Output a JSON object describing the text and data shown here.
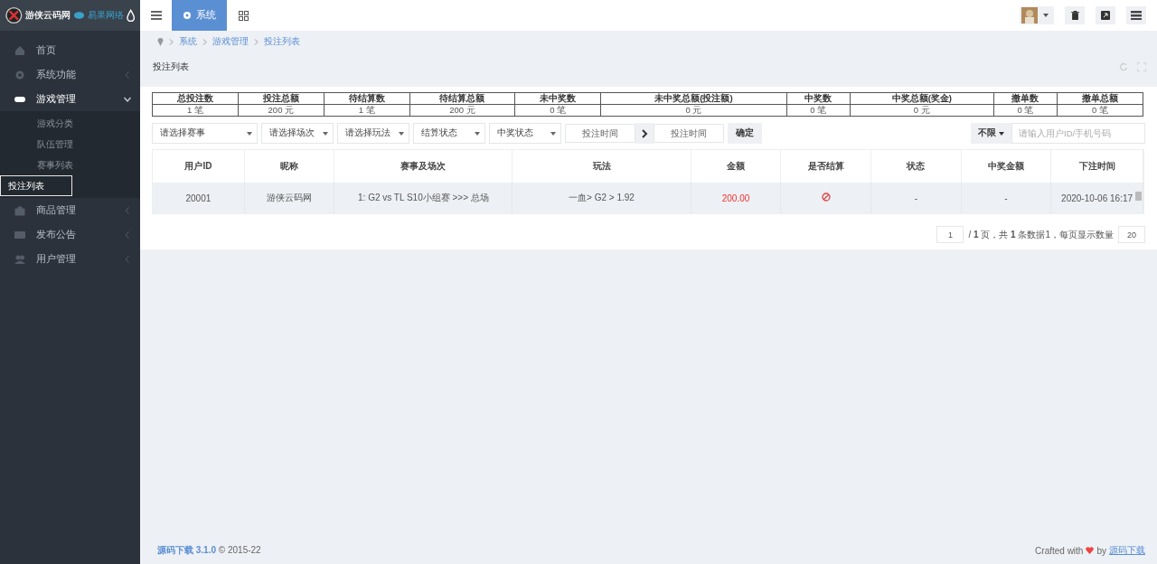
{
  "logo": {
    "brand": "游侠云码网",
    "partner": "易果网络"
  },
  "topbar": {
    "tabs": [
      {
        "label": "系统",
        "selected": true
      }
    ]
  },
  "sidebar": {
    "items": [
      {
        "label": "首页",
        "kind": "link"
      },
      {
        "label": "系统功能",
        "kind": "group",
        "expanded": false
      },
      {
        "label": "游戏管理",
        "kind": "group",
        "expanded": true,
        "children": [
          {
            "label": "游戏分类",
            "selected": false
          },
          {
            "label": "队伍管理",
            "selected": false
          },
          {
            "label": "赛事列表",
            "selected": false
          },
          {
            "label": "投注列表",
            "selected": true
          }
        ]
      },
      {
        "label": "商品管理",
        "kind": "group",
        "expanded": false
      },
      {
        "label": "发布公告",
        "kind": "group",
        "expanded": false
      },
      {
        "label": "用户管理",
        "kind": "group",
        "expanded": false
      }
    ]
  },
  "breadcrumb": [
    "系统",
    "游戏管理",
    "投注列表"
  ],
  "panel": {
    "title": "投注列表"
  },
  "stats": [
    {
      "label": "总投注数",
      "value": "1 笔"
    },
    {
      "label": "投注总额",
      "value": "200 元"
    },
    {
      "label": "待结算数",
      "value": "1 笔"
    },
    {
      "label": "待结算总额",
      "value": "200 元"
    },
    {
      "label": "未中奖数",
      "value": "0 笔"
    },
    {
      "label": "未中奖总额(投注额)",
      "value": "0 元"
    },
    {
      "label": "中奖数",
      "value": "0 笔"
    },
    {
      "label": "中奖总额(奖金)",
      "value": "0 元"
    },
    {
      "label": "撤单数",
      "value": "0 笔"
    },
    {
      "label": "撤单总额",
      "value": "0 笔"
    }
  ],
  "filters": {
    "selects": [
      "请选择赛事",
      "请选择场次",
      "请选择玩法",
      "结算状态",
      "中奖状态"
    ],
    "date_from": {
      "placeholder": "投注时间"
    },
    "date_to": {
      "placeholder": "投注时间"
    },
    "confirm": "确定",
    "scope": "不限",
    "search": {
      "placeholder": "请输入用户ID/手机号码"
    }
  },
  "table": {
    "columns": [
      "用户ID",
      "昵称",
      "赛事及场次",
      "玩法",
      "金额",
      "是否结算",
      "状态",
      "中奖金额",
      "下注时间"
    ],
    "rows": [
      {
        "user_id": "20001",
        "nickname": "游侠云码网",
        "match": "1: G2 vs TL S10小组赛 >>> 总场",
        "play": "一血> G2 > 1.92",
        "amount": "200.00",
        "settled": false,
        "status": "-",
        "prize": "-",
        "time": "2020-10-06 16:17"
      }
    ]
  },
  "pagination": {
    "page": "1",
    "summary": "/ **1** 页，共 **1** 条数据1，每页显示数量",
    "page_size": "20"
  },
  "footer": {
    "link": "源码下载 3.1.0",
    "copyright": "© 2015-22",
    "crafted": "Crafted with",
    "by": "by",
    "author": "源码下载"
  }
}
